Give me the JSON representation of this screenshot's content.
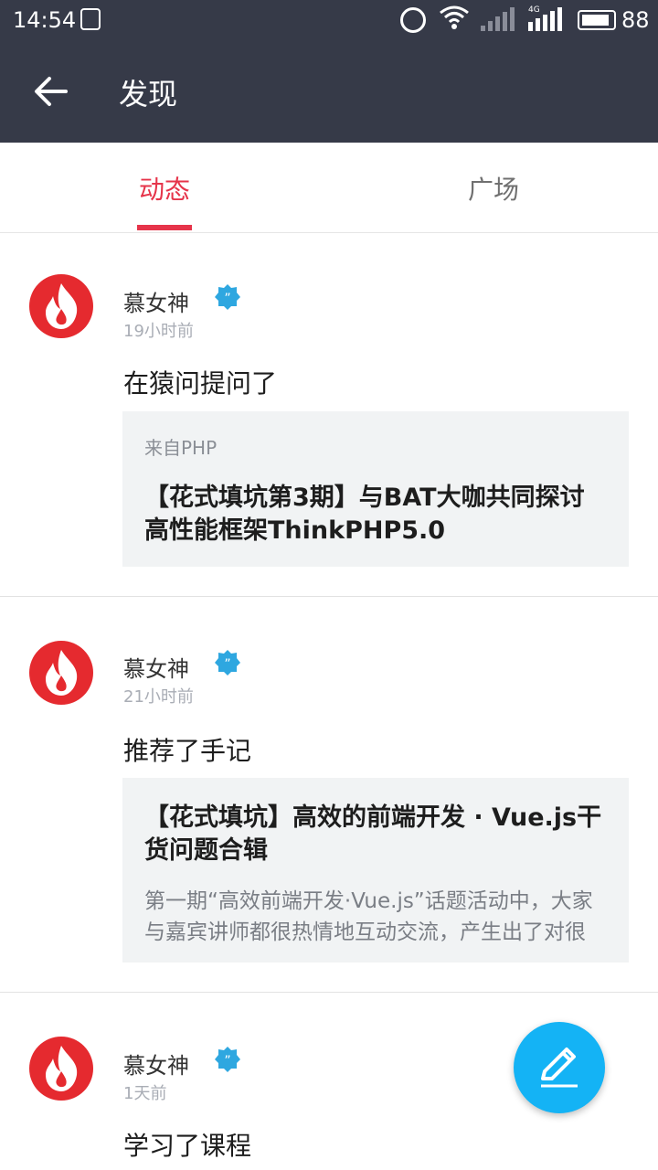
{
  "status_bar": {
    "time": "14:54",
    "battery": "88",
    "network": "4G"
  },
  "app_bar": {
    "title": "发现"
  },
  "tabs": [
    {
      "label": "动态",
      "active": true
    },
    {
      "label": "广场",
      "active": false
    }
  ],
  "feed": [
    {
      "user": "慕女神",
      "time": "19小时前",
      "action": "在猿问提问了",
      "card": {
        "source": "来自PHP",
        "title": "【花式填坑第3期】与BAT大咖共同探讨高性能框架ThinkPHP5.0"
      }
    },
    {
      "user": "慕女神",
      "time": "21小时前",
      "action": "推荐了手记",
      "card": {
        "title": "【花式填坑】高效的前端开发 · Vue.js干货问题合辑",
        "description": "第一期“高效前端开发·Vue.js”话题活动中，大家与嘉宾讲师都很热情地互动交流，产生出了对很"
      }
    },
    {
      "user": "慕女神",
      "time": "1天前",
      "action": "学习了课程"
    }
  ],
  "colors": {
    "accent": "#e6344a",
    "fab": "#14b3f5",
    "header": "#363a48"
  },
  "icons": {
    "back": "arrow-left-icon",
    "verified": "verified-badge-icon",
    "fab": "pencil-icon"
  }
}
